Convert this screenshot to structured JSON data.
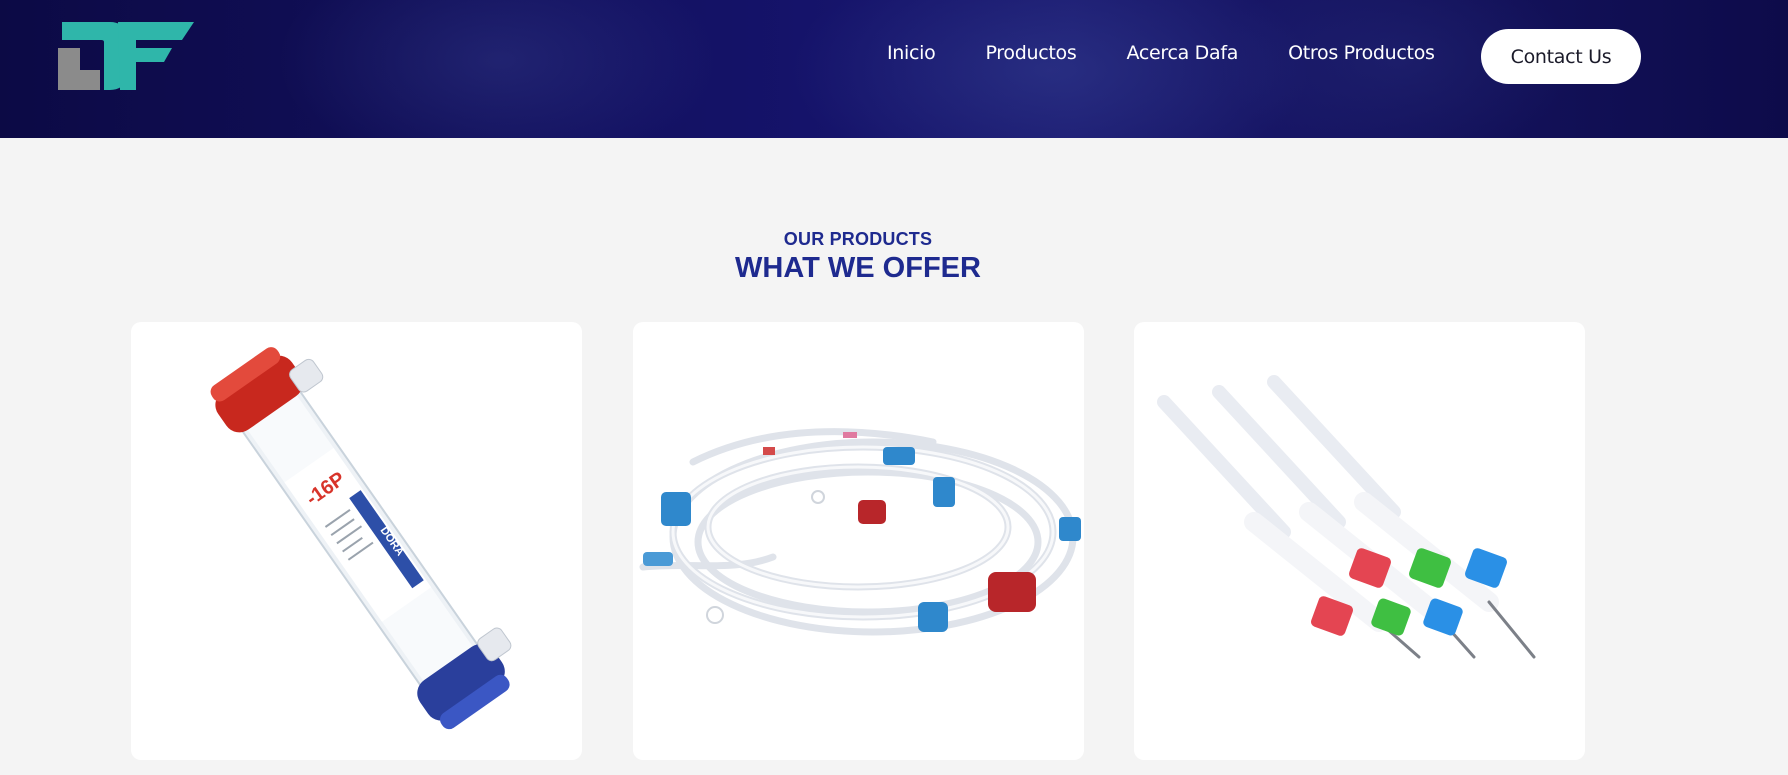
{
  "header": {
    "logo_text": "DF",
    "nav": [
      {
        "label": "Inicio"
      },
      {
        "label": "Productos"
      },
      {
        "label": "Acerca Dafa"
      },
      {
        "label": "Otros Productos"
      }
    ],
    "contact_label": "Contact Us"
  },
  "section": {
    "eyebrow": "OUR PRODUCTS",
    "title": "WHAT WE OFFER"
  },
  "products": [
    {
      "image": "dialyzer-filter",
      "label_text": "-16P",
      "brand_text": "DORA"
    },
    {
      "image": "blood-tubing-line-set"
    },
    {
      "image": "fistula-needles"
    }
  ],
  "colors": {
    "header_bg": "#0c0a45",
    "accent_teal": "#2bb3a8",
    "logo_grey": "#8a8a8a",
    "title_blue": "#1e2a8f",
    "page_bg": "#f4f4f4"
  }
}
